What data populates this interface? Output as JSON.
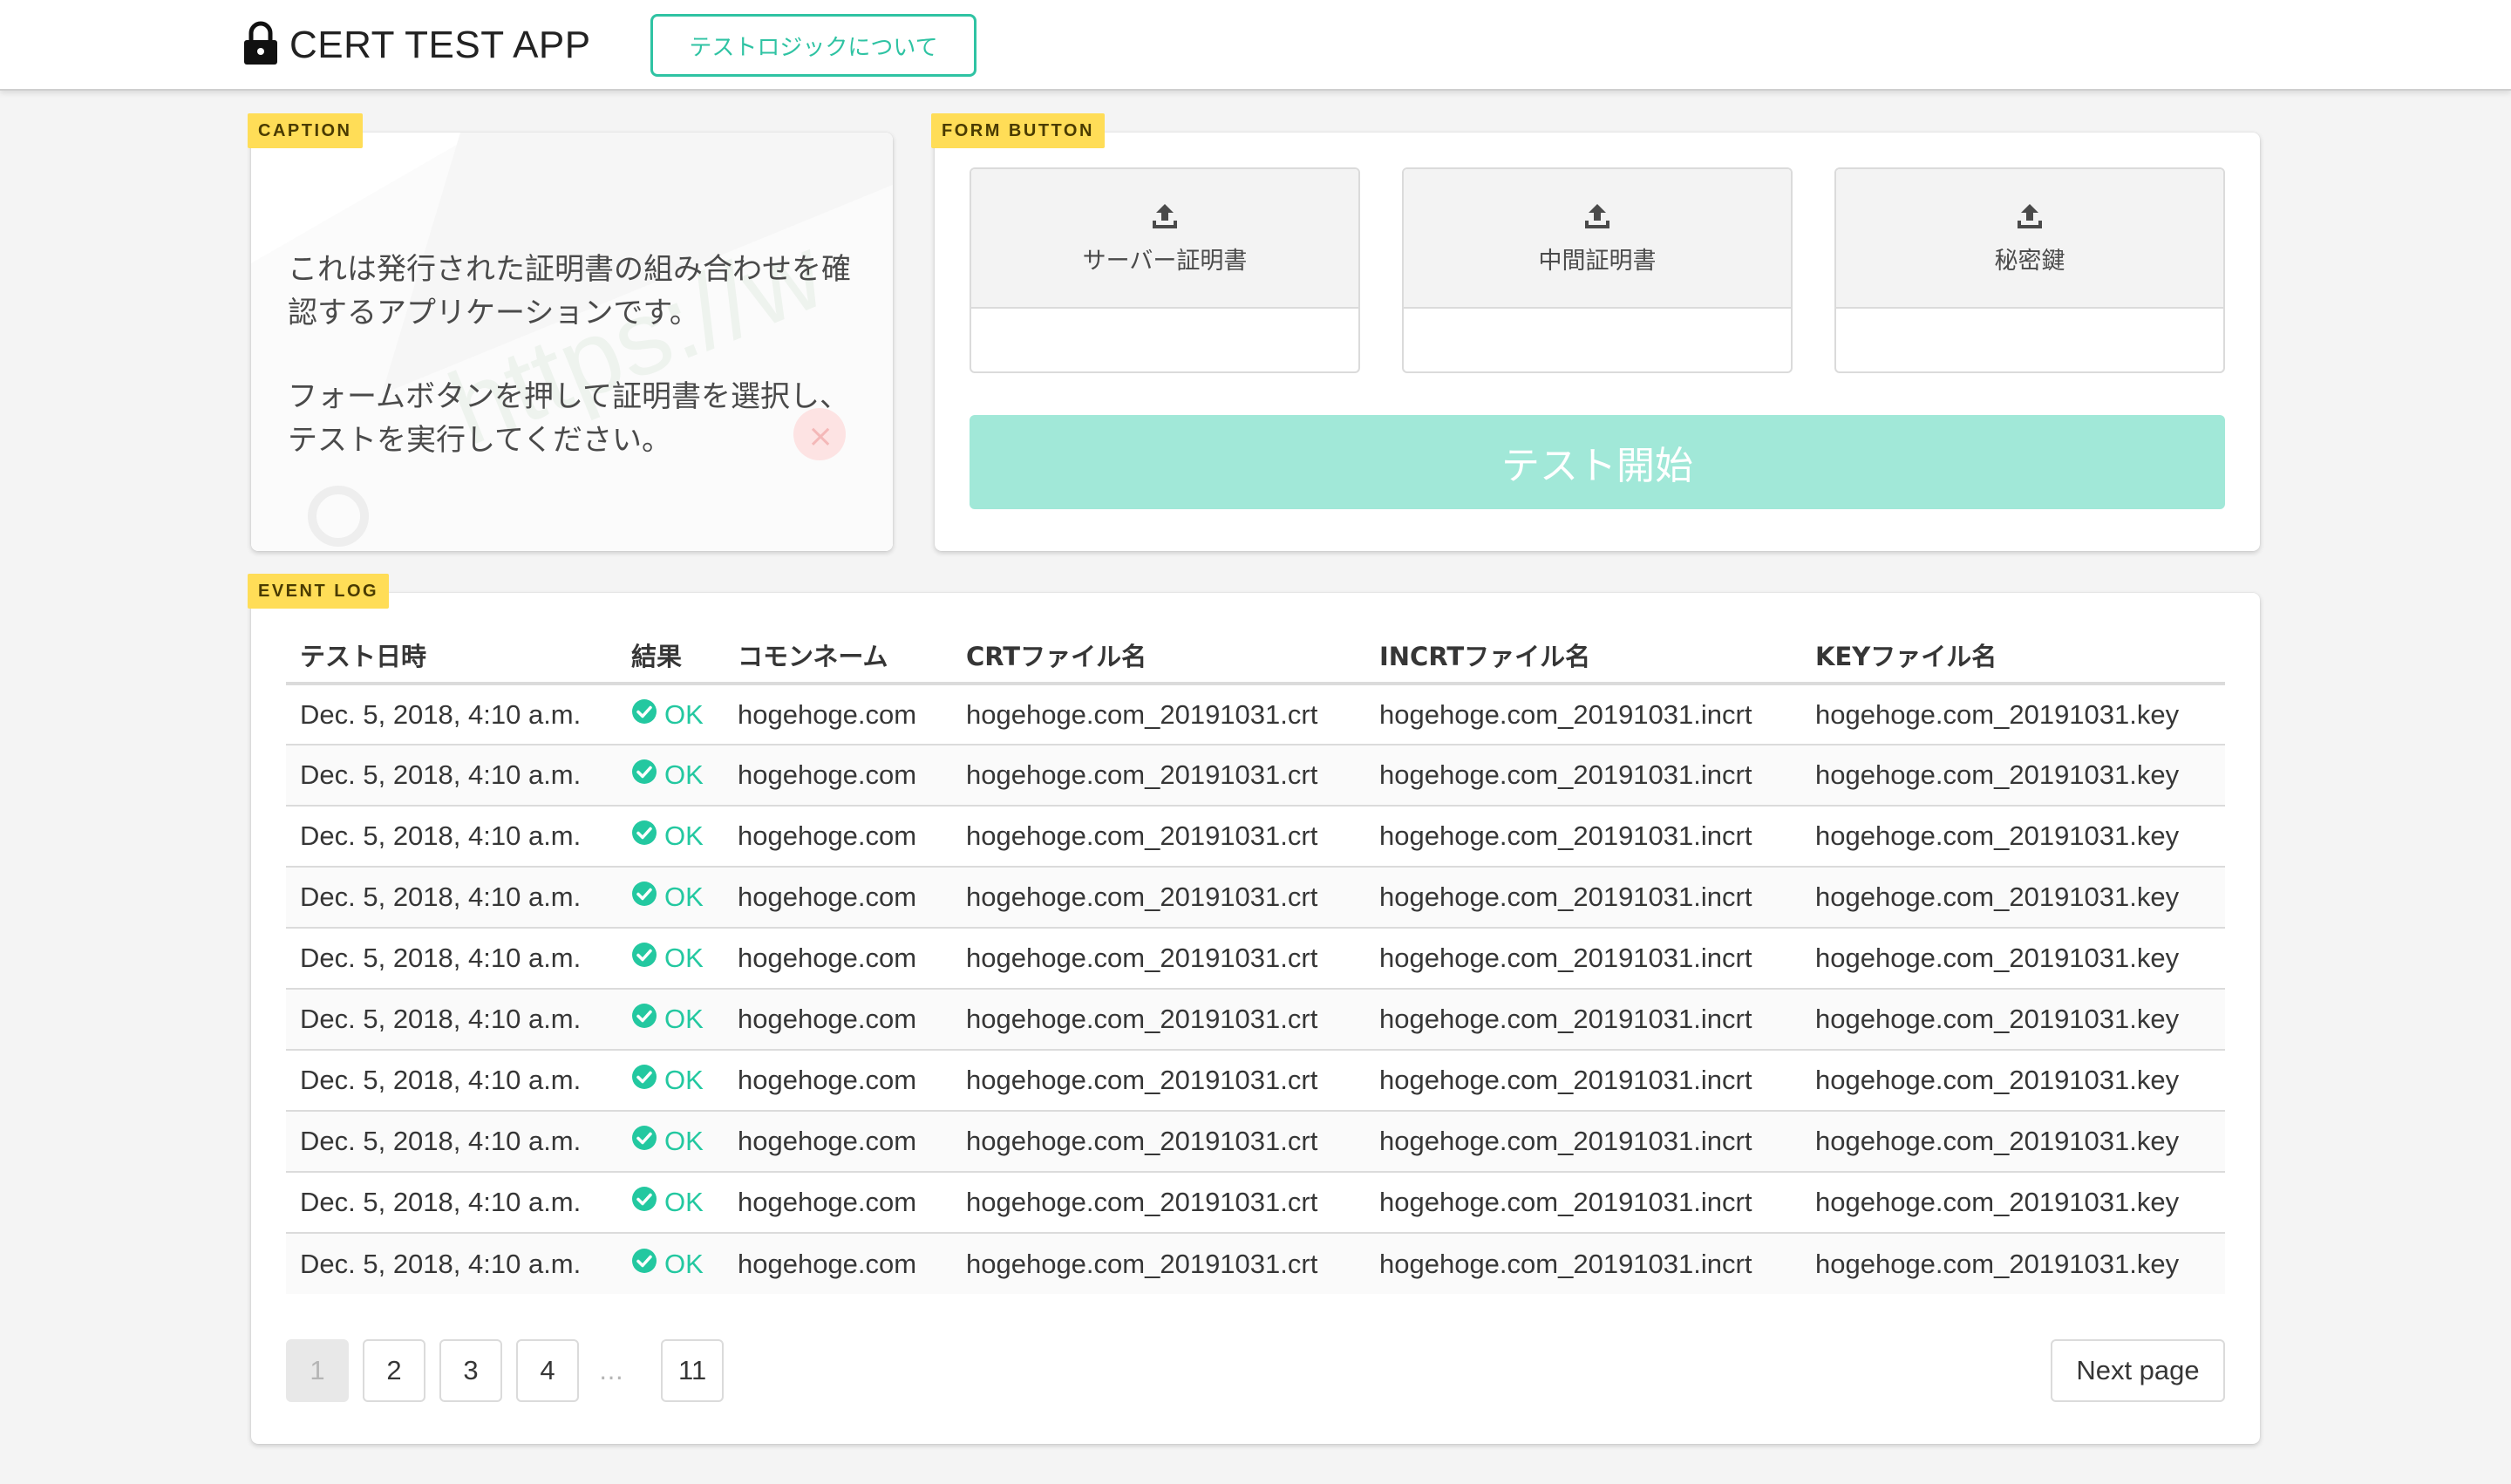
{
  "header": {
    "app_title": "CERT TEST APP",
    "about_button": "テストロジックについて"
  },
  "caption": {
    "tag": "CAPTION",
    "paragraph1": "これは発行された証明書の組み合わせを確認するアプリケーションです。",
    "paragraph2": "フォームボタンを押して証明書を選択し、テストを実行してください。"
  },
  "form": {
    "tag": "FORM BUTTON",
    "uploads": [
      {
        "label": "サーバー証明書",
        "filename": ""
      },
      {
        "label": "中間証明書",
        "filename": ""
      },
      {
        "label": "秘密鍵",
        "filename": ""
      }
    ],
    "start_button": "テスト開始",
    "colors": {
      "accent": "#2fc3a3",
      "start_disabled": "#a1e8d8"
    }
  },
  "log": {
    "tag": "EVENT LOG",
    "columns": [
      "テスト日時",
      "結果",
      "コモンネーム",
      "CRTファイル名",
      "INCRTファイル名",
      "KEYファイル名"
    ],
    "rows": [
      {
        "date": "Dec. 5, 2018, 4:10 a.m.",
        "result": "OK",
        "cn": "hogehoge.com",
        "crt": "hogehoge.com_20191031.crt",
        "incrt": "hogehoge.com_20191031.incrt",
        "key": "hogehoge.com_20191031.key"
      },
      {
        "date": "Dec. 5, 2018, 4:10 a.m.",
        "result": "OK",
        "cn": "hogehoge.com",
        "crt": "hogehoge.com_20191031.crt",
        "incrt": "hogehoge.com_20191031.incrt",
        "key": "hogehoge.com_20191031.key"
      },
      {
        "date": "Dec. 5, 2018, 4:10 a.m.",
        "result": "OK",
        "cn": "hogehoge.com",
        "crt": "hogehoge.com_20191031.crt",
        "incrt": "hogehoge.com_20191031.incrt",
        "key": "hogehoge.com_20191031.key"
      },
      {
        "date": "Dec. 5, 2018, 4:10 a.m.",
        "result": "OK",
        "cn": "hogehoge.com",
        "crt": "hogehoge.com_20191031.crt",
        "incrt": "hogehoge.com_20191031.incrt",
        "key": "hogehoge.com_20191031.key"
      },
      {
        "date": "Dec. 5, 2018, 4:10 a.m.",
        "result": "OK",
        "cn": "hogehoge.com",
        "crt": "hogehoge.com_20191031.crt",
        "incrt": "hogehoge.com_20191031.incrt",
        "key": "hogehoge.com_20191031.key"
      },
      {
        "date": "Dec. 5, 2018, 4:10 a.m.",
        "result": "OK",
        "cn": "hogehoge.com",
        "crt": "hogehoge.com_20191031.crt",
        "incrt": "hogehoge.com_20191031.incrt",
        "key": "hogehoge.com_20191031.key"
      },
      {
        "date": "Dec. 5, 2018, 4:10 a.m.",
        "result": "OK",
        "cn": "hogehoge.com",
        "crt": "hogehoge.com_20191031.crt",
        "incrt": "hogehoge.com_20191031.incrt",
        "key": "hogehoge.com_20191031.key"
      },
      {
        "date": "Dec. 5, 2018, 4:10 a.m.",
        "result": "OK",
        "cn": "hogehoge.com",
        "crt": "hogehoge.com_20191031.crt",
        "incrt": "hogehoge.com_20191031.incrt",
        "key": "hogehoge.com_20191031.key"
      },
      {
        "date": "Dec. 5, 2018, 4:10 a.m.",
        "result": "OK",
        "cn": "hogehoge.com",
        "crt": "hogehoge.com_20191031.crt",
        "incrt": "hogehoge.com_20191031.incrt",
        "key": "hogehoge.com_20191031.key"
      },
      {
        "date": "Dec. 5, 2018, 4:10 a.m.",
        "result": "OK",
        "cn": "hogehoge.com",
        "crt": "hogehoge.com_20191031.crt",
        "incrt": "hogehoge.com_20191031.incrt",
        "key": "hogehoge.com_20191031.key"
      }
    ],
    "result_color": "#23c8a0"
  },
  "pagination": {
    "pages": [
      "1",
      "2",
      "3",
      "4"
    ],
    "ellipsis": "…",
    "last_page": "11",
    "current_page": "1",
    "next_label": "Next page"
  }
}
